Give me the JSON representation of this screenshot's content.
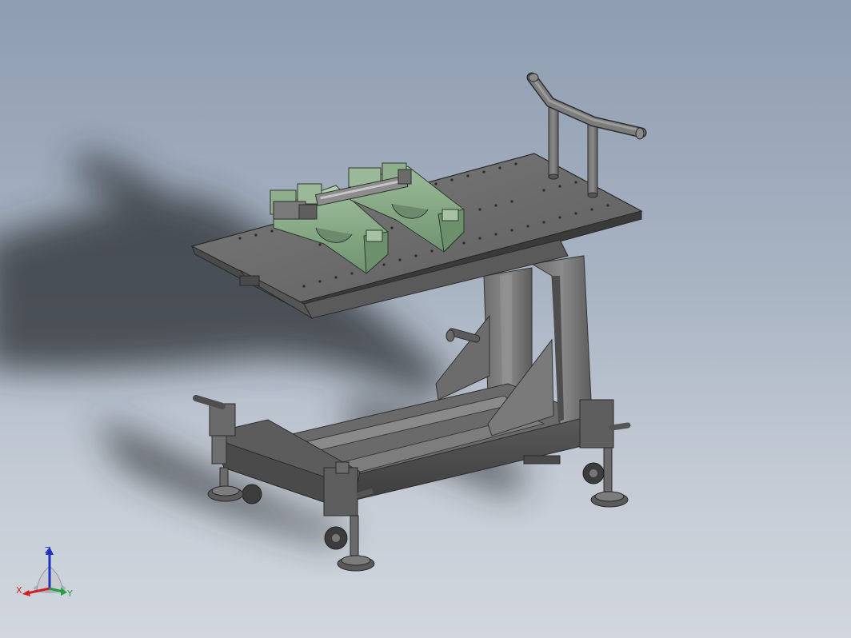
{
  "viewport": {
    "background_top": "#8e9db1",
    "background_bottom": "#d2d7de"
  },
  "model": {
    "fixture_color": "#8fb08c",
    "frame_color": "#707070"
  },
  "triad": {
    "x_label": "X",
    "y_label": "Y",
    "z_label": "Z",
    "x_color": "#d02020",
    "y_color": "#20a040",
    "z_color": "#2030c0"
  }
}
